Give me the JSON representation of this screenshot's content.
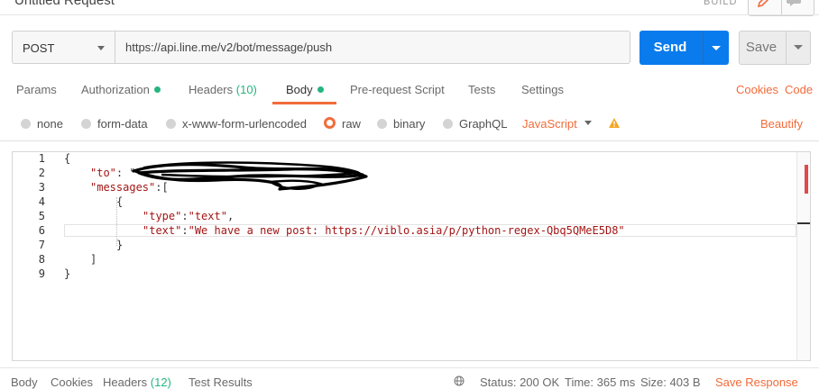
{
  "request": {
    "title": "Untitled Request",
    "build_label": "BUILD",
    "method": "POST",
    "url": "https://api.line.me/v2/bot/message/push",
    "send_label": "Send",
    "save_label": "Save"
  },
  "tabs": {
    "params": "Params",
    "authorization": "Authorization",
    "headers": "Headers",
    "headers_count": "(10)",
    "body": "Body",
    "pre_request": "Pre-request Script",
    "tests": "Tests",
    "settings": "Settings",
    "cookies": "Cookies",
    "code": "Code"
  },
  "body_types": {
    "none": "none",
    "form_data": "form-data",
    "urlencoded": "x-www-form-urlencoded",
    "raw": "raw",
    "binary": "binary",
    "graphql": "GraphQL",
    "language": "JavaScript",
    "beautify": "Beautify"
  },
  "editor": {
    "line_numbers": [
      "1",
      "2",
      "3",
      "4",
      "5",
      "6",
      "7",
      "8",
      "9"
    ],
    "l1": "{",
    "l2_key": "\"to\"",
    "l2_punct": ": \"",
    "l3_key": "\"messages\"",
    "l3_punct": ":[",
    "l4": "{",
    "l5_key": "\"type\"",
    "l5_punct": ":",
    "l5_val": "\"text\"",
    "l5_end": ",",
    "l6_key": "\"text\"",
    "l6_punct": ":",
    "l6_val": "\"We have a new post: https://viblo.asia/p/python-regex-Qbq5QMeE5D8\"",
    "l7": "}",
    "l8": "]",
    "l9": "}"
  },
  "response_bar": {
    "body": "Body",
    "cookies": "Cookies",
    "headers": "Headers",
    "headers_count": "(12)",
    "test_results": "Test Results",
    "status": "Status: 200 OK",
    "time": "Time: 365 ms",
    "size": "Size: 403 B",
    "save_response": "Save Response"
  },
  "colors": {
    "accent": "#f26b3a",
    "send_blue": "#097bed",
    "active_dot": "#26b47f"
  }
}
